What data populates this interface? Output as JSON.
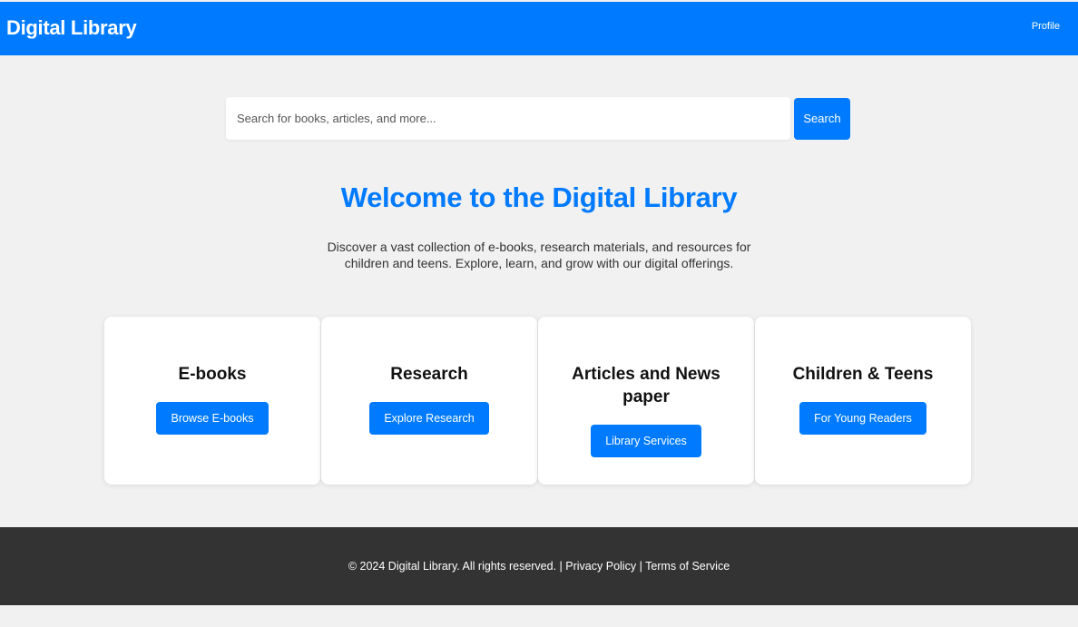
{
  "header": {
    "brand": "Digital Library",
    "profile_label": "Profile"
  },
  "search": {
    "placeholder": "Search for books, articles, and more...",
    "value": "",
    "button_label": "Search"
  },
  "welcome": {
    "title": "Welcome to the Digital Library",
    "description": "Discover a vast collection of e-books, research materials, and resources for children and teens. Explore, learn, and grow with our digital offerings."
  },
  "cards": [
    {
      "title": "E-books",
      "button_label": "Browse E-books"
    },
    {
      "title": "Research",
      "button_label": "Explore Research"
    },
    {
      "title": "Articles and News paper",
      "button_label": "Library Services"
    },
    {
      "title": "Children & Teens",
      "button_label": "For Young Readers"
    }
  ],
  "footer": {
    "copyright": "© 2024 Digital Library. All rights reserved.",
    "separator": "|",
    "privacy_label": "Privacy Policy",
    "terms_label": "Terms of Service"
  },
  "colors": {
    "accent": "#007bff",
    "background": "#f1f1f1",
    "footer_background": "#333333",
    "card_background": "#ffffff"
  }
}
